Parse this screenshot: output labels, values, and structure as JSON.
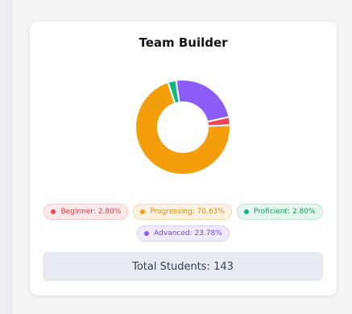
{
  "card": {
    "title": "Team Builder",
    "total_students": "Total Students: 143"
  },
  "legend": [
    {
      "label": "Beginner: 2.80%",
      "color": "#ef4452"
    },
    {
      "label": "Progressing: 70.63%",
      "color": "#f59e0b"
    },
    {
      "label": "Proficient: 2.80%",
      "color": "#10b981"
    },
    {
      "label": "Advanced: 23.78%",
      "color": "#8b5cf6"
    }
  ],
  "chart_data": {
    "type": "pie",
    "title": "Team Builder",
    "categories": [
      "Beginner",
      "Progressing",
      "Proficient",
      "Advanced"
    ],
    "values": [
      2.8,
      70.63,
      2.8,
      23.78
    ],
    "colors": [
      "#ef4452",
      "#f59e0b",
      "#10b981",
      "#8b5cf6"
    ],
    "donut": true,
    "total": 143
  }
}
